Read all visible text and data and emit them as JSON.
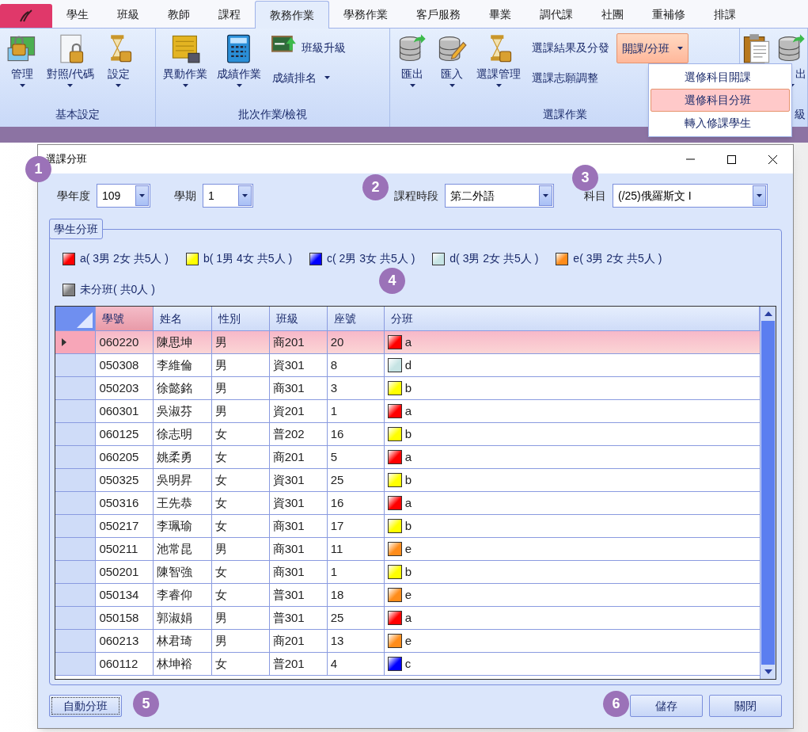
{
  "app_button": {
    "selected": false
  },
  "tabs": [
    {
      "label": "學生",
      "selected": false
    },
    {
      "label": "班級",
      "selected": false
    },
    {
      "label": "教師",
      "selected": false
    },
    {
      "label": "課程",
      "selected": false
    },
    {
      "label": "教務作業",
      "selected": true
    },
    {
      "label": "學務作業",
      "selected": false
    },
    {
      "label": "客戶服務",
      "selected": false
    },
    {
      "label": "畢業",
      "selected": false
    },
    {
      "label": "調代課",
      "selected": false
    },
    {
      "label": "社團",
      "selected": false
    },
    {
      "label": "重補修",
      "selected": false
    },
    {
      "label": "排課",
      "selected": false
    }
  ],
  "ribbon_groups": [
    {
      "label": "基本設定",
      "items": [
        {
          "kind": "large",
          "label": "管理",
          "dropdown": true
        },
        {
          "kind": "large",
          "label": "對照/代碼",
          "dropdown": true
        },
        {
          "kind": "large",
          "label": "設定",
          "dropdown": true
        }
      ]
    },
    {
      "label": "批次作業/檢視",
      "items": [
        {
          "kind": "large",
          "label": "異動作業",
          "dropdown": true
        },
        {
          "kind": "large",
          "label": "成績作業",
          "dropdown": true
        },
        {
          "kind": "stack",
          "items": [
            {
              "kind": "small",
              "label": "班級升級",
              "dropdown": false
            },
            {
              "kind": "text",
              "label": "成績排名",
              "dropdown": true
            }
          ]
        }
      ]
    },
    {
      "label": "選課作業",
      "items": [
        {
          "kind": "large",
          "label": "匯出",
          "dropdown": true
        },
        {
          "kind": "large",
          "label": "匯入",
          "dropdown": true
        },
        {
          "kind": "large",
          "label": "選課管理",
          "dropdown": true
        },
        {
          "kind": "stack",
          "items": [
            {
              "kind": "text",
              "label": "選課結果及分發",
              "dropdown": false
            },
            {
              "kind": "text",
              "label": "選課志願調整",
              "dropdown": false
            }
          ]
        },
        {
          "kind": "stack",
          "items": [
            {
              "kind": "split",
              "label": "開課/分班",
              "dropdown": true,
              "active": true
            }
          ]
        }
      ]
    },
    {
      "label": "級",
      "items": [
        {
          "kind": "large",
          "dropdown": false
        },
        {
          "kind": "large",
          "label": "出",
          "dropdown": true
        }
      ]
    }
  ],
  "menu": [
    {
      "label": "選修科目開課",
      "selected": false
    },
    {
      "label": "選修科目分班",
      "selected": true
    },
    {
      "label": "轉入修課學生",
      "selected": false
    }
  ],
  "dialog": {
    "title": "選課分班",
    "filters": [
      {
        "label": "學年度",
        "value": "109"
      },
      {
        "label": "學期",
        "value": "1"
      },
      {
        "label": "課程時段",
        "value": "第二外語"
      },
      {
        "label": "科目",
        "value": "(/25)俄羅斯文 I"
      }
    ],
    "group_title": "學生分班",
    "legend": [
      {
        "label": "a( 3男 2女 共5人 )",
        "color": "#ff0000"
      },
      {
        "label": "b( 1男 4女 共5人 )",
        "color": "#ffff00"
      },
      {
        "label": "c( 2男 3女 共5人 )",
        "color": "#0000ff"
      },
      {
        "label": "d( 3男 2女 共5人 )",
        "color": "#c6e4e4"
      },
      {
        "label": "e( 3男 2女 共5人 )",
        "color": "#ff8c1a"
      },
      {
        "label": "未分班( 共0人 )",
        "color": "#808080"
      }
    ],
    "columns": [
      "學號",
      "姓名",
      "性別",
      "班級",
      "座號",
      "分班"
    ],
    "rows": [
      {
        "cells": [
          "060220",
          "陳思坤",
          "男",
          "商201",
          "20"
        ],
        "section": "a",
        "color": "#ff0000",
        "selected": true
      },
      {
        "cells": [
          "050308",
          "李維倫",
          "男",
          "資301",
          "8"
        ],
        "section": "d",
        "color": "#c6e4e4",
        "selected": false
      },
      {
        "cells": [
          "050203",
          "徐懿銘",
          "男",
          "商301",
          "3"
        ],
        "section": "b",
        "color": "#ffff00",
        "selected": false
      },
      {
        "cells": [
          "060301",
          "吳淑芬",
          "男",
          "資201",
          "1"
        ],
        "section": "a",
        "color": "#ff0000",
        "selected": false
      },
      {
        "cells": [
          "060125",
          "徐志明",
          "女",
          "普202",
          "16"
        ],
        "section": "b",
        "color": "#ffff00",
        "selected": false
      },
      {
        "cells": [
          "060205",
          "姚柔勇",
          "女",
          "商201",
          "5"
        ],
        "section": "a",
        "color": "#ff0000",
        "selected": false
      },
      {
        "cells": [
          "050325",
          "吳明昇",
          "女",
          "資301",
          "25"
        ],
        "section": "b",
        "color": "#ffff00",
        "selected": false
      },
      {
        "cells": [
          "050316",
          "王先恭",
          "女",
          "資301",
          "16"
        ],
        "section": "a",
        "color": "#ff0000",
        "selected": false
      },
      {
        "cells": [
          "050217",
          "李珮瑜",
          "女",
          "商301",
          "17"
        ],
        "section": "b",
        "color": "#ffff00",
        "selected": false
      },
      {
        "cells": [
          "050211",
          "池常昆",
          "男",
          "商301",
          "11"
        ],
        "section": "e",
        "color": "#ff8c1a",
        "selected": false
      },
      {
        "cells": [
          "050201",
          "陳智強",
          "女",
          "商301",
          "1"
        ],
        "section": "b",
        "color": "#ffff00",
        "selected": false
      },
      {
        "cells": [
          "050134",
          "李睿仰",
          "女",
          "普301",
          "18"
        ],
        "section": "e",
        "color": "#ff8c1a",
        "selected": false
      },
      {
        "cells": [
          "050158",
          "郭淑娟",
          "男",
          "普301",
          "25"
        ],
        "section": "a",
        "color": "#ff0000",
        "selected": false
      },
      {
        "cells": [
          "060213",
          "林君琦",
          "男",
          "商201",
          "13"
        ],
        "section": "e",
        "color": "#ff8c1a",
        "selected": false
      },
      {
        "cells": [
          "060112",
          "林坤裕",
          "女",
          "普201",
          "4"
        ],
        "section": "c",
        "color": "#0000ff",
        "selected": false
      }
    ],
    "buttons": [
      {
        "label": "自動分班",
        "kind": "left"
      },
      {
        "label": "儲存",
        "kind": "right"
      },
      {
        "label": "關閉",
        "kind": "right"
      }
    ]
  },
  "annotations": [
    "1",
    "2",
    "3",
    "4",
    "5",
    "6"
  ]
}
